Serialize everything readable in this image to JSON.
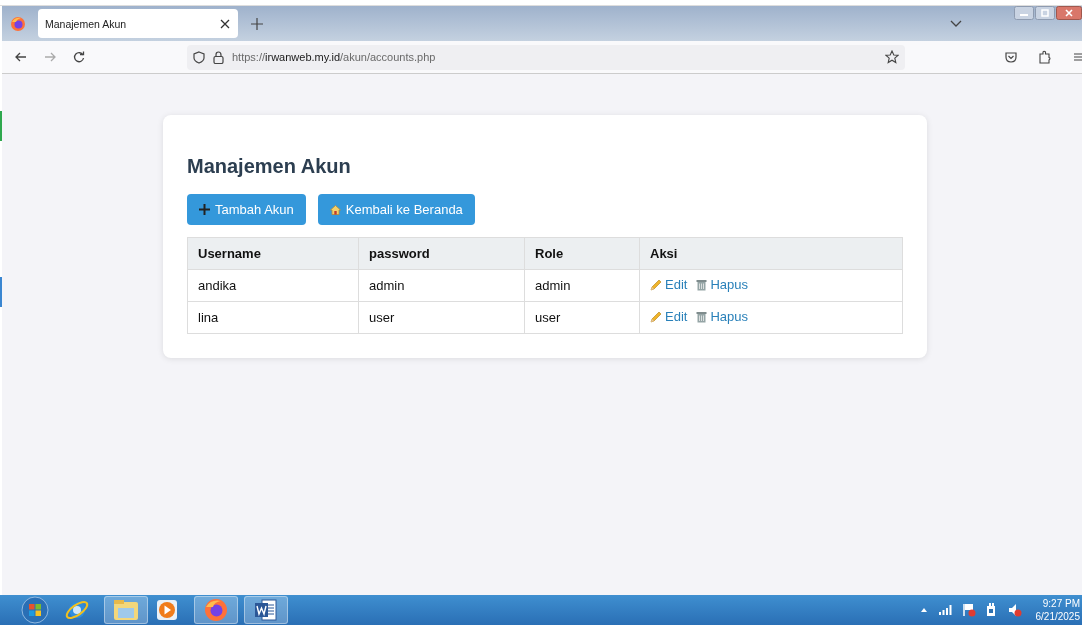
{
  "browser": {
    "tab_title": "Manajemen Akun",
    "url": {
      "scheme": "https://",
      "domain": "irwanweb.my.id",
      "path": "/akun/accounts.php"
    }
  },
  "page": {
    "title": "Manajemen Akun",
    "buttons": [
      {
        "kind": "add",
        "label": "Tambah Akun"
      },
      {
        "kind": "home",
        "label": "Kembali ke Beranda"
      }
    ],
    "table": {
      "columns": [
        "Username",
        "password",
        "Role",
        "Aksi"
      ],
      "rows": [
        {
          "username": "andika",
          "password": "admin",
          "role": "admin",
          "actions": [
            {
              "kind": "edit",
              "label": "Edit"
            },
            {
              "kind": "delete",
              "label": "Hapus"
            }
          ]
        },
        {
          "username": "lina",
          "password": "user",
          "role": "user",
          "actions": [
            {
              "kind": "edit",
              "label": "Edit"
            },
            {
              "kind": "delete",
              "label": "Hapus"
            }
          ]
        }
      ]
    }
  },
  "taskbar": {
    "time": "9:27 PM",
    "date": "6/21/2025"
  }
}
